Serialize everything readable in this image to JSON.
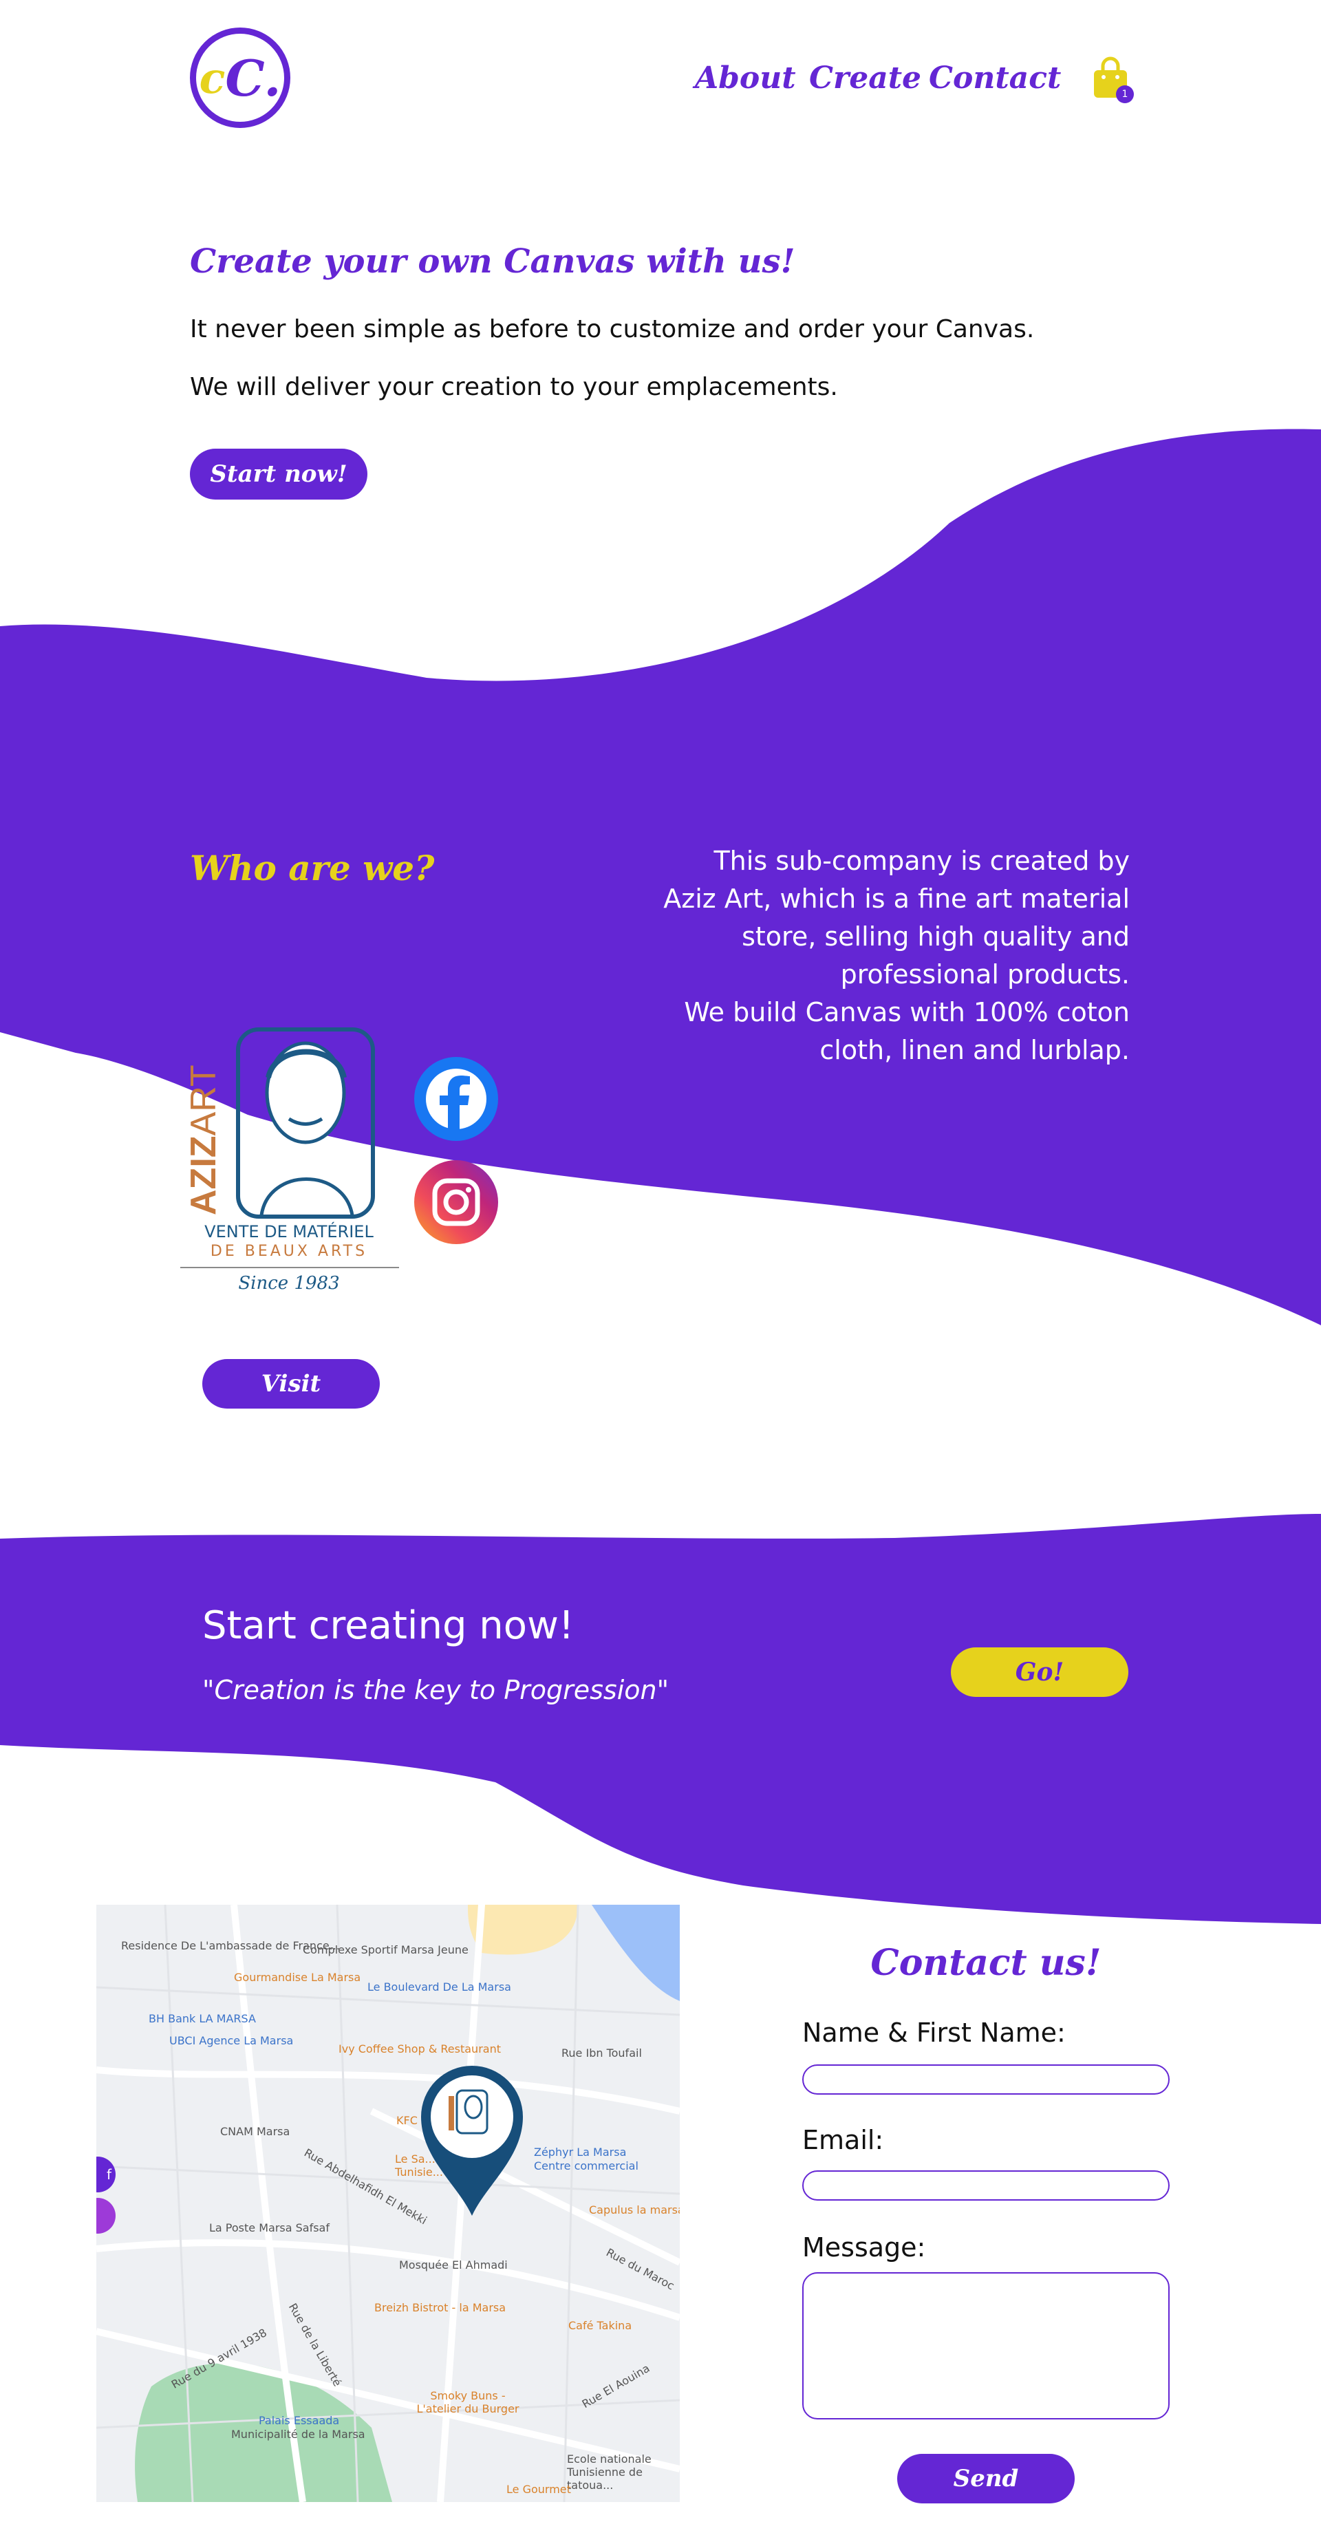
{
  "header": {
    "logo_c1": "c",
    "logo_c2": "C.",
    "nav": [
      "About",
      "Create",
      "Contact"
    ],
    "cart_count": "1",
    "cart_icon": "shopping-bag-icon"
  },
  "hero": {
    "title": "Create your own Canvas with us!",
    "line1": "It never been simple as before to customize and order your Canvas.",
    "line2": "We will deliver your creation to your emplacements.",
    "button": "Start now!"
  },
  "who": {
    "title": "Who are we?",
    "text": [
      "This sub-company is created by",
      "Aziz Art, which is a fine art material",
      "store,  selling high quality and",
      "professional products.",
      "We build Canvas with 100% coton",
      "cloth, linen and lurblap."
    ],
    "partner_logo": {
      "brand_a": "AZIZ",
      "brand_b": "ART",
      "sub1": "VENTE DE MATÉRIEL",
      "sub2": "DE BEAUX ARTS",
      "since": "Since 1983"
    },
    "social_icons": [
      "facebook-icon",
      "instagram-icon"
    ],
    "button": "Visit"
  },
  "create": {
    "title": "Start creating now!",
    "quote": "\"Creation is the key to Progression\"",
    "button": "Go!"
  },
  "map": {
    "labels": [
      "Residence De L'ambassade de France...",
      "Complexe Sportif Marsa Jeune",
      "Gourmandise La Marsa",
      "Le Boulevard De La Marsa",
      "BH Bank LA MARSA",
      "UBCI Agence La Marsa",
      "Ivy Coffee Shop & Restaurant",
      "Rue Ibn Toufail",
      "CNAM Marsa",
      "Zéphyr La Marsa",
      "Centre commercial",
      "Capulus la marsa",
      "La Poste Marsa Safsaf",
      "Mosquée El Ahmadi",
      "Rue du Maroc",
      "Breizh Bistrot - la Marsa",
      "Café Takina",
      "Smoky Buns - L'atelier du Burger",
      "Palais Essaada",
      "Municipalité de la Marsa",
      "Ecole nationale Tunisienne de tatoua...",
      "Le Gourmet",
      "Rue Abdelhafidh El Mekki",
      "Rue El Aouina",
      "Rue du 9 avril 1938",
      "Rue de la Liberté",
      "KFC",
      "Le Sa... Tunisie..."
    ],
    "pin_icon": "map-pin-icon"
  },
  "contact": {
    "title": "Contact us!",
    "name_label": "Name & First Name:",
    "email_label": "Email:",
    "message_label": "Message:",
    "button": "Send"
  },
  "colors": {
    "primary": "#6426d4",
    "accent": "#e6d21c",
    "text": "#111111"
  }
}
